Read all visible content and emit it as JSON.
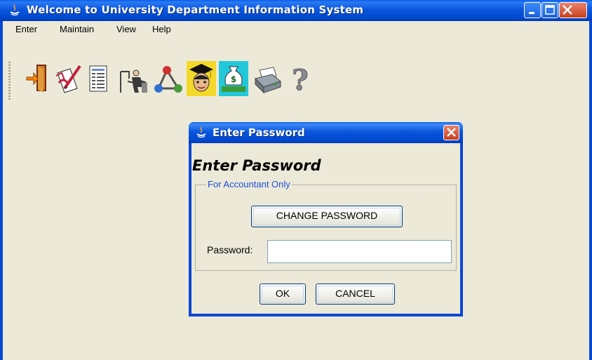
{
  "window": {
    "title": "Welcome to University Department Information System"
  },
  "menu": {
    "items": [
      "Enter",
      "Maintain",
      "View",
      "Help"
    ]
  },
  "toolbar": {
    "tools": [
      {
        "icon": "exit-door-icon"
      },
      {
        "icon": "edit-document-icon"
      },
      {
        "icon": "report-sheet-icon"
      },
      {
        "icon": "teacher-icon"
      },
      {
        "icon": "network-molecule-icon"
      },
      {
        "icon": "graduate-student-icon"
      },
      {
        "icon": "money-bag-icon"
      },
      {
        "icon": "printer-icon"
      },
      {
        "icon": "help-question-icon"
      }
    ]
  },
  "dialog": {
    "title": "Enter Password",
    "heading": "Enter Password",
    "group_title": "For Accountant Only",
    "change_password_label": "CHANGE PASSWORD",
    "password_label": "Password:",
    "password_value": "",
    "ok_label": "OK",
    "cancel_label": "CANCEL"
  },
  "colors": {
    "titlebar": "#0a56dd",
    "face": "#ece9d8",
    "close_red": "#c8401f",
    "group_title": "#1e4fd8"
  }
}
